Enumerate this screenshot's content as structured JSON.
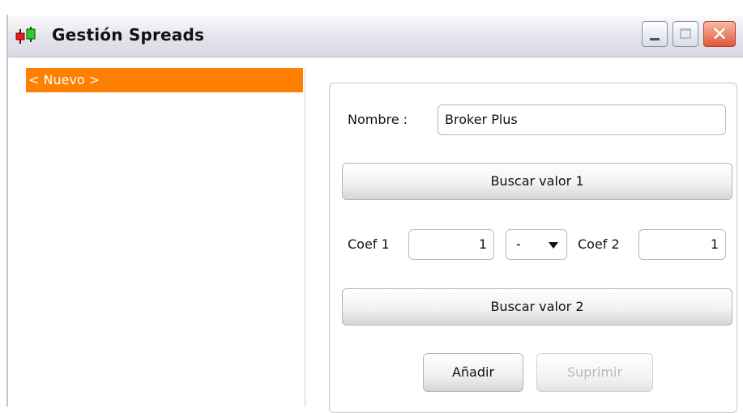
{
  "window": {
    "title": "Gestión Spreads",
    "controls": {
      "minimize": "minimize",
      "maximize": "maximize",
      "close": "✕"
    }
  },
  "list": {
    "items": [
      {
        "label": "< Nuevo >",
        "selected": true
      }
    ]
  },
  "form": {
    "nombre_label": "Nombre :",
    "nombre_value": "Broker Plus",
    "buscar_valor_1": "Buscar valor 1",
    "coef1_label": "Coef 1",
    "coef1_value": "1",
    "operator_value": "-",
    "coef2_label": "Coef 2",
    "coef2_value": "1",
    "buscar_valor_2": "Buscar valor 2",
    "anadir_label": "Añadir",
    "suprimir_label": "Suprimir"
  },
  "colors": {
    "selection": "#ff7f00",
    "close_button": "#e0583a"
  }
}
